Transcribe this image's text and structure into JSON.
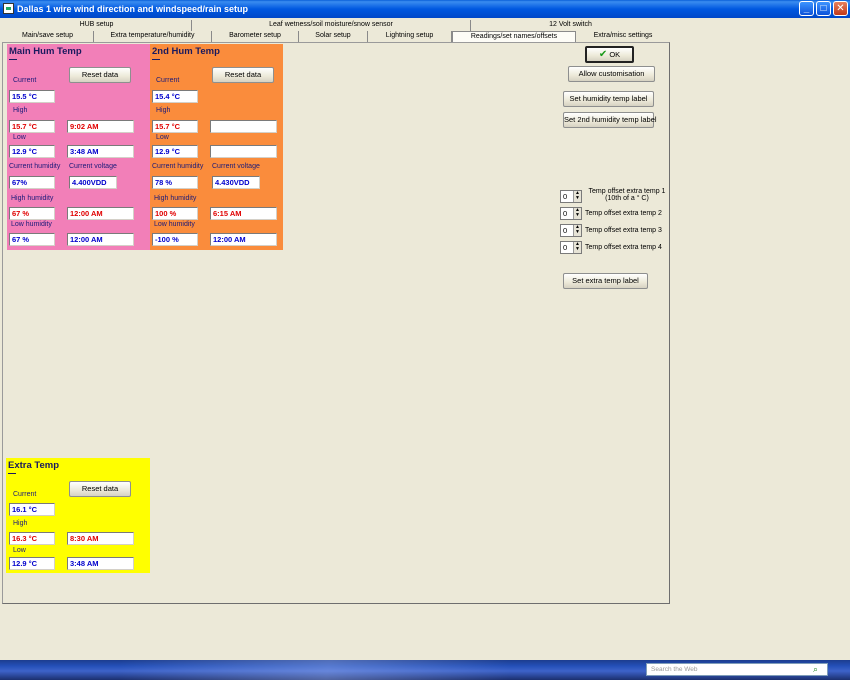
{
  "window": {
    "title": "Dallas 1 wire wind direction and windspeed/rain setup"
  },
  "tabs_row1": [
    "HUB setup",
    "Leaf wetness/soil moisture/snow sensor",
    "12 Volt switch"
  ],
  "tabs_row2": [
    "Main/save setup",
    "Extra temperature/humidity",
    "Barometer setup",
    "Solar setup",
    "Lightning setup",
    "Readings/set names/offsets",
    "Extra/misc settings"
  ],
  "main_hum": {
    "title": "Main Hum Temp",
    "reset_label": "Reset data",
    "current_label": "Current",
    "current": "15.5 °C",
    "high_label": "High",
    "high": "15.7 °C",
    "high_time": "9:02 AM",
    "low_label": "Low",
    "low": "12.9 °C",
    "low_time": "3:48 AM",
    "cur_hum_label": "Current humidity",
    "cur_hum": "67%",
    "cur_volt_label": "Current voltage",
    "cur_volt": "4.400VDD",
    "high_hum_label": "High humidity",
    "high_hum": "67 %",
    "high_hum_time": "12:00 AM",
    "low_hum_label": "Low humidity",
    "low_hum": "67 %",
    "low_hum_time": "12:00 AM"
  },
  "second_hum": {
    "title": "2nd  Hum Temp",
    "reset_label": "Reset data",
    "current_label": "Current",
    "current": "15.4 °C",
    "high_label": "High",
    "high": "15.7 °C",
    "high_time": "",
    "low_label": "Low",
    "low": "12.9 °C",
    "low_time": "",
    "cur_hum_label": "Current humidity",
    "cur_hum": "78 %",
    "cur_volt_label": "Current voltage",
    "cur_volt": "4.430VDD",
    "high_hum_label": "High humidity",
    "high_hum": "100 %",
    "high_hum_time": "6:15 AM",
    "low_hum_label": "Low humidity",
    "low_hum": "-100 %",
    "low_hum_time": "12:00 AM"
  },
  "extra_temp": {
    "title": "Extra Temp",
    "reset_label": "Reset data",
    "current_label": "Current",
    "current": "16.1 °C",
    "high_label": "High",
    "high": "16.3 °C",
    "high_time": "8:30 AM",
    "low_label": "Low",
    "low": "12.9 °C",
    "low_time": "3:48 AM"
  },
  "right": {
    "ok_label": "OK",
    "allow_customisation": "Allow customisation",
    "set_humidity_label": "Set humidity temp label",
    "set_2nd_humidity_label": "Set 2nd humidity temp label",
    "offsets": [
      {
        "value": "0",
        "label": "Temp offset extra temp 1",
        "sub": "(10th of a ° C)"
      },
      {
        "value": "0",
        "label": "Temp offset extra temp 2",
        "sub": ""
      },
      {
        "value": "0",
        "label": "Temp offset extra temp 3",
        "sub": ""
      },
      {
        "value": "0",
        "label": "Temp offset extra temp 4",
        "sub": ""
      }
    ],
    "set_extra_label": "Set extra temp label"
  },
  "taskbar": {
    "search_placeholder": "Search the Web"
  },
  "colors": {
    "main_panel": "#f27fb8",
    "second_panel": "#fa8c3c",
    "extra_panel": "#ffff00",
    "value_blue": "#0000cc",
    "value_red": "#e00000"
  }
}
